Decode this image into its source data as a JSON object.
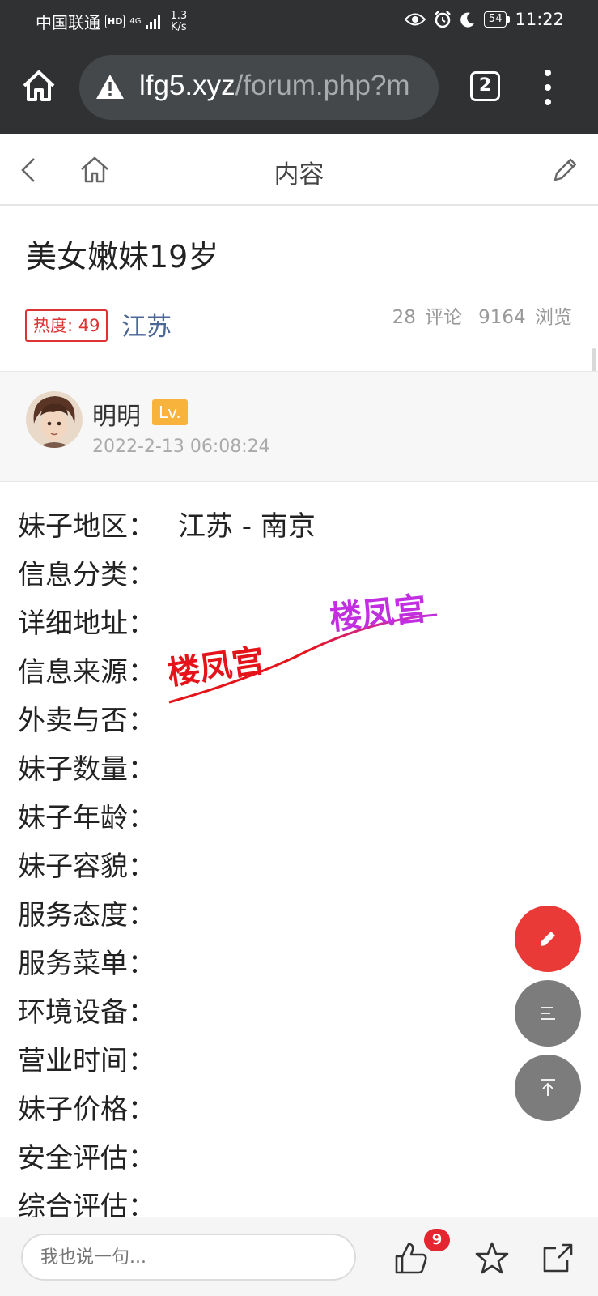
{
  "status_bar": {
    "carrier": "中国联通",
    "hd": "HD",
    "network": "4G",
    "speed_value": "1.3",
    "speed_unit": "K/s",
    "battery": "54",
    "time": "11:22"
  },
  "browser": {
    "url_host": "lfg5.xyz",
    "url_path": "/forum.php?m",
    "tab_count": "2"
  },
  "nav": {
    "title": "内容"
  },
  "post": {
    "title": "美女嫩妹19岁",
    "heat": "热度: 49",
    "region": "江苏",
    "comments": "28 评论",
    "views": "9164 浏览"
  },
  "author": {
    "name": "明明",
    "level": "Lv.",
    "date": "2022-2-13 06:08:24"
  },
  "content": {
    "rows": [
      {
        "label": "妹子地区：",
        "value": "江苏 - 南京"
      },
      {
        "label": "信息分类：",
        "value": ""
      },
      {
        "label": "详细地址：",
        "value": ""
      },
      {
        "label": "信息来源：",
        "value": ""
      },
      {
        "label": "外卖与否：",
        "value": ""
      },
      {
        "label": "妹子数量：",
        "value": ""
      },
      {
        "label": "妹子年龄：",
        "value": ""
      },
      {
        "label": "妹子容貌：",
        "value": ""
      },
      {
        "label": "服务态度：",
        "value": ""
      },
      {
        "label": "服务菜单：",
        "value": ""
      },
      {
        "label": "环境设备：",
        "value": ""
      },
      {
        "label": "营业时间：",
        "value": ""
      },
      {
        "label": "妹子价格：",
        "value": ""
      },
      {
        "label": "安全评估：",
        "value": ""
      },
      {
        "label": "综合评估：",
        "value": ""
      }
    ],
    "watermark": "楼凤宫"
  },
  "bottom": {
    "input_placeholder": "我也说一句...",
    "like_count": "9"
  },
  "colors": {
    "accent_red": "#ea3a37",
    "region_blue": "#4a6795",
    "level_orange": "#f7b33b",
    "chrome_dark": "#2f3133"
  }
}
